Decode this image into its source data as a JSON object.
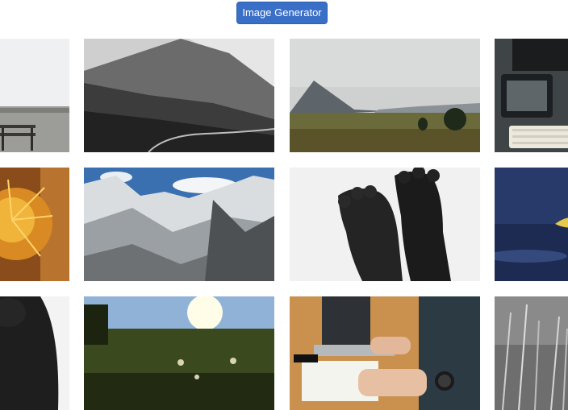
{
  "toolbar": {
    "generate_button_label": "Image Generator"
  },
  "gallery": {
    "images": [
      {
        "subject": "bench-by-snowy-field",
        "row": 0,
        "col": 0
      },
      {
        "subject": "black-white-mountain-valley",
        "row": 0,
        "col": 1
      },
      {
        "subject": "mountain-meadow-cloudy",
        "row": 0,
        "col": 2
      },
      {
        "subject": "tablet-keyboard-desk",
        "row": 0,
        "col": 3
      },
      {
        "subject": "orange-spiky-flower",
        "row": 1,
        "col": 0
      },
      {
        "subject": "snowy-mountain-range",
        "row": 1,
        "col": 1
      },
      {
        "subject": "feet-silhouette",
        "row": 1,
        "col": 2
      },
      {
        "subject": "leaf-on-blue-water",
        "row": 1,
        "col": 3
      },
      {
        "subject": "foot-silhouette-closeup",
        "row": 2,
        "col": 0
      },
      {
        "subject": "sunlit-grass-field",
        "row": 2,
        "col": 1
      },
      {
        "subject": "laptop-notebook-writing",
        "row": 2,
        "col": 2
      },
      {
        "subject": "grass-closeup-bw",
        "row": 2,
        "col": 3
      }
    ]
  }
}
